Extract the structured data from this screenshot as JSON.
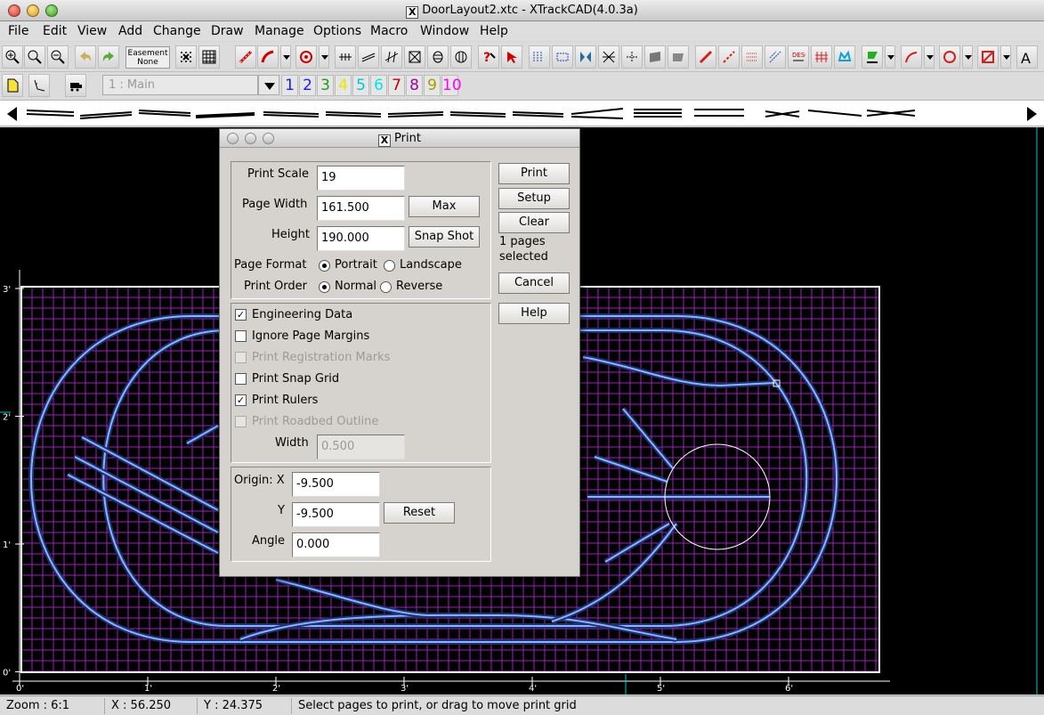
{
  "window": {
    "title": "DoorLayout2.xtc - XTrackCAD(4.0.3a)",
    "x_glyph": "X"
  },
  "menu": [
    "File",
    "Edit",
    "View",
    "Add",
    "Change",
    "Draw",
    "Manage",
    "Options",
    "Macro",
    "Window",
    "Help"
  ],
  "toolbar": {
    "easement_line1": "Easement",
    "easement_line2": "None",
    "layer_value": "1 : Main",
    "layers": [
      {
        "label": "1",
        "color": "#1a1aff"
      },
      {
        "label": "2",
        "color": "#1a1aff"
      },
      {
        "label": "3",
        "color": "#1e9a1e"
      },
      {
        "label": "4",
        "color": "#e6e600"
      },
      {
        "label": "5",
        "color": "#00c8c8"
      },
      {
        "label": "6",
        "color": "#00e6e6"
      },
      {
        "label": "7",
        "color": "#c00000"
      },
      {
        "label": "8",
        "color": "#a000a0"
      },
      {
        "label": "9",
        "color": "#a0a000"
      },
      {
        "label": "10",
        "color": "#ff00ff"
      }
    ]
  },
  "canvas": {
    "grid_color": "#a020c0",
    "track_color": "#8ab4ff",
    "x_ruler": [
      "0'",
      "1'",
      "2'",
      "3'",
      "4'",
      "5'",
      "6'"
    ],
    "y_ruler": [
      "3'",
      "2'",
      "1'",
      "0'"
    ]
  },
  "status": {
    "zoom": "Zoom : 6:1",
    "x": "X : 56.250",
    "y": "Y : 24.375",
    "message": "Select pages to print, or drag to move print grid"
  },
  "dialog": {
    "title": "Print",
    "print_scale_label": "Print Scale",
    "print_scale_value": "19",
    "page_width_label": "Page Width",
    "page_width_value": "161.500",
    "max_button": "Max",
    "height_label": "Height",
    "height_value": "190.000",
    "snapshot_button": "Snap Shot",
    "page_format_label": "Page Format",
    "portrait": "Portrait",
    "landscape": "Landscape",
    "print_order_label": "Print Order",
    "normal": "Normal",
    "reverse": "Reverse",
    "engineering_data": "Engineering Data",
    "ignore_margins": "Ignore Page Margins",
    "registration_marks": "Print Registration Marks",
    "snap_grid": "Print Snap Grid",
    "rulers": "Print Rulers",
    "roadbed_outline": "Print Roadbed Outline",
    "width_label": "Width",
    "width_value": "0.500",
    "origin_x_label": "Origin: X",
    "origin_x_value": "-9.500",
    "y_label": "Y",
    "y_value": "-9.500",
    "reset_button": "Reset",
    "angle_label": "Angle",
    "angle_value": "0.000",
    "print_button": "Print",
    "setup_button": "Setup",
    "clear_button": "Clear",
    "pages_selected": "1 pages",
    "pages_selected_2": "selected",
    "cancel_button": "Cancel",
    "help_button": "Help",
    "check_mark": "✓"
  }
}
